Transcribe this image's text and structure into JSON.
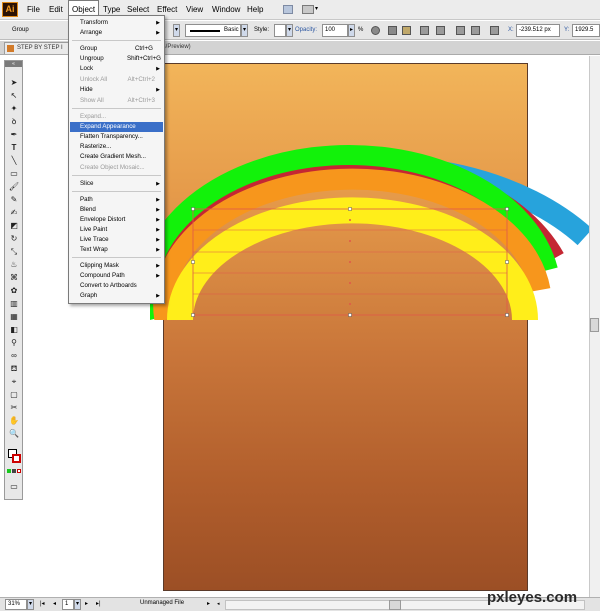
{
  "app": {
    "logo": "Ai"
  },
  "menubar": {
    "items": [
      {
        "label": "File"
      },
      {
        "label": "Edit"
      },
      {
        "label": "Object"
      },
      {
        "label": "Type"
      },
      {
        "label": "Select"
      },
      {
        "label": "Effect"
      },
      {
        "label": "View"
      },
      {
        "label": "Window"
      },
      {
        "label": "Help"
      }
    ]
  },
  "controlbar": {
    "selection_label": "Group",
    "stroke_style_label": "Basic",
    "style_label": "Style:",
    "opacity_label": "Opacity:",
    "opacity_value": "100",
    "opacity_unit": "%",
    "x_label": "X:",
    "x_value": "-239.512 px",
    "y_label": "Y:",
    "y_value": "1929.5"
  },
  "tab": {
    "title": "STEP BY STEP I",
    "suffix": "GB/Preview)"
  },
  "object_menu": {
    "items": [
      {
        "label": "Transform",
        "submenu": true
      },
      {
        "label": "Arrange",
        "submenu": true
      },
      {
        "label": "Group",
        "shortcut": "Ctrl+G"
      },
      {
        "label": "Ungroup",
        "shortcut": "Shift+Ctrl+G"
      },
      {
        "label": "Lock",
        "submenu": true
      },
      {
        "label": "Unlock All",
        "shortcut": "Alt+Ctrl+2",
        "disabled": true
      },
      {
        "label": "Hide",
        "submenu": true
      },
      {
        "label": "Show All",
        "shortcut": "Alt+Ctrl+3",
        "disabled": true
      },
      {
        "label": "Expand...",
        "disabled": true
      },
      {
        "label": "Expand Appearance",
        "highlight": true
      },
      {
        "label": "Flatten Transparency..."
      },
      {
        "label": "Rasterize..."
      },
      {
        "label": "Create Gradient Mesh..."
      },
      {
        "label": "Create Object Mosaic...",
        "disabled": true
      },
      {
        "label": "Slice",
        "submenu": true
      },
      {
        "label": "Path",
        "submenu": true
      },
      {
        "label": "Blend",
        "submenu": true
      },
      {
        "label": "Envelope Distort",
        "submenu": true
      },
      {
        "label": "Live Paint",
        "submenu": true
      },
      {
        "label": "Live Trace",
        "submenu": true
      },
      {
        "label": "Text Wrap",
        "submenu": true
      },
      {
        "label": "Clipping Mask",
        "submenu": true
      },
      {
        "label": "Compound Path",
        "submenu": true
      },
      {
        "label": "Convert to Artboards"
      },
      {
        "label": "Graph",
        "submenu": true
      }
    ]
  },
  "status": {
    "zoom": "31%",
    "page": "1",
    "file_state": "Unmanaged File"
  },
  "watermark": "pxleyes.com",
  "colors": {
    "rainbow_blue": "#27a3dc",
    "rainbow_red": "#c42733",
    "rainbow_green": "#12f20a",
    "rainbow_orange": "#f7961c",
    "rainbow_yellow": "#ffee1a",
    "menu_highlight": "#3a6fc8"
  }
}
